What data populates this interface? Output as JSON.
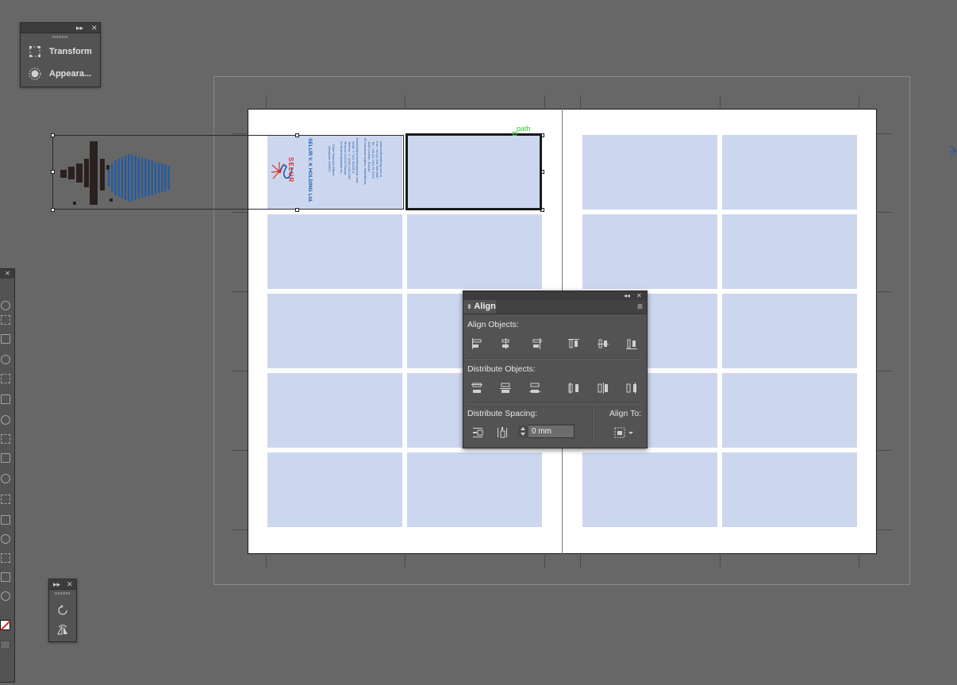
{
  "panels": {
    "transform_panel": {
      "items": [
        {
          "label": "Transform",
          "icon": "transform-icon"
        },
        {
          "label": "Appeara...",
          "icon": "appearance-icon"
        }
      ],
      "collapse_glyph": "▸▸",
      "close_glyph": "✕"
    },
    "small_panel": {
      "collapse_glyph": "▸▸",
      "close_glyph": "✕"
    },
    "toolbar": {
      "close_glyph": "✕"
    }
  },
  "canvas": {
    "selection_label": "path",
    "card_text": {
      "logo_text": "SELUR",
      "company": "SELUR V. K HOLDING Ltd.",
      "person": "Alexander ZAROV",
      "role": "Chief Financial Officer",
      "address_1": "52 Bolshevistskaya str.,",
      "address_2": "Moscow 112345 Russia",
      "tel": "Tel/Fax: +7 (495) 235-9463",
      "gsm": "GSM: +7 921 5510576",
      "email": "balamut@serkolinmygroup.com",
      "address_3": "58 Industrial organs, Hakhdehad,",
      "address_4": "1000 London, Russia",
      "tel_2": "Tel.: +44 (0) 2031 51 5153",
      "fax_2": "Fax: +44 (0) 208 955 8887",
      "web": "www.sellerwalbag.com.ru"
    }
  },
  "align_panel": {
    "tab_label": "Align",
    "collapse_glyph": "◂◂",
    "close_glyph": "✕",
    "menu_glyph": "≡",
    "align_objects_label": "Align Objects:",
    "distribute_objects_label": "Distribute Objects:",
    "distribute_spacing_label": "Distribute Spacing:",
    "align_to_label": "Align To:",
    "spacing_value": "0 mm",
    "align_buttons": [
      "horizontal-align-left",
      "horizontal-align-center",
      "horizontal-align-right",
      "vertical-align-top",
      "vertical-align-center",
      "vertical-align-bottom"
    ],
    "distribute_buttons": [
      "vertical-distribute-top",
      "vertical-distribute-center",
      "vertical-distribute-bottom",
      "horizontal-distribute-left",
      "horizontal-distribute-center",
      "horizontal-distribute-right"
    ]
  },
  "colors": {
    "workspace": "#676767",
    "panel": "#535353",
    "card_fill": "#ccd7ef",
    "selection_green": "#33cc33",
    "card_blue": "#1e5aa8",
    "card_red": "#d8332a"
  }
}
